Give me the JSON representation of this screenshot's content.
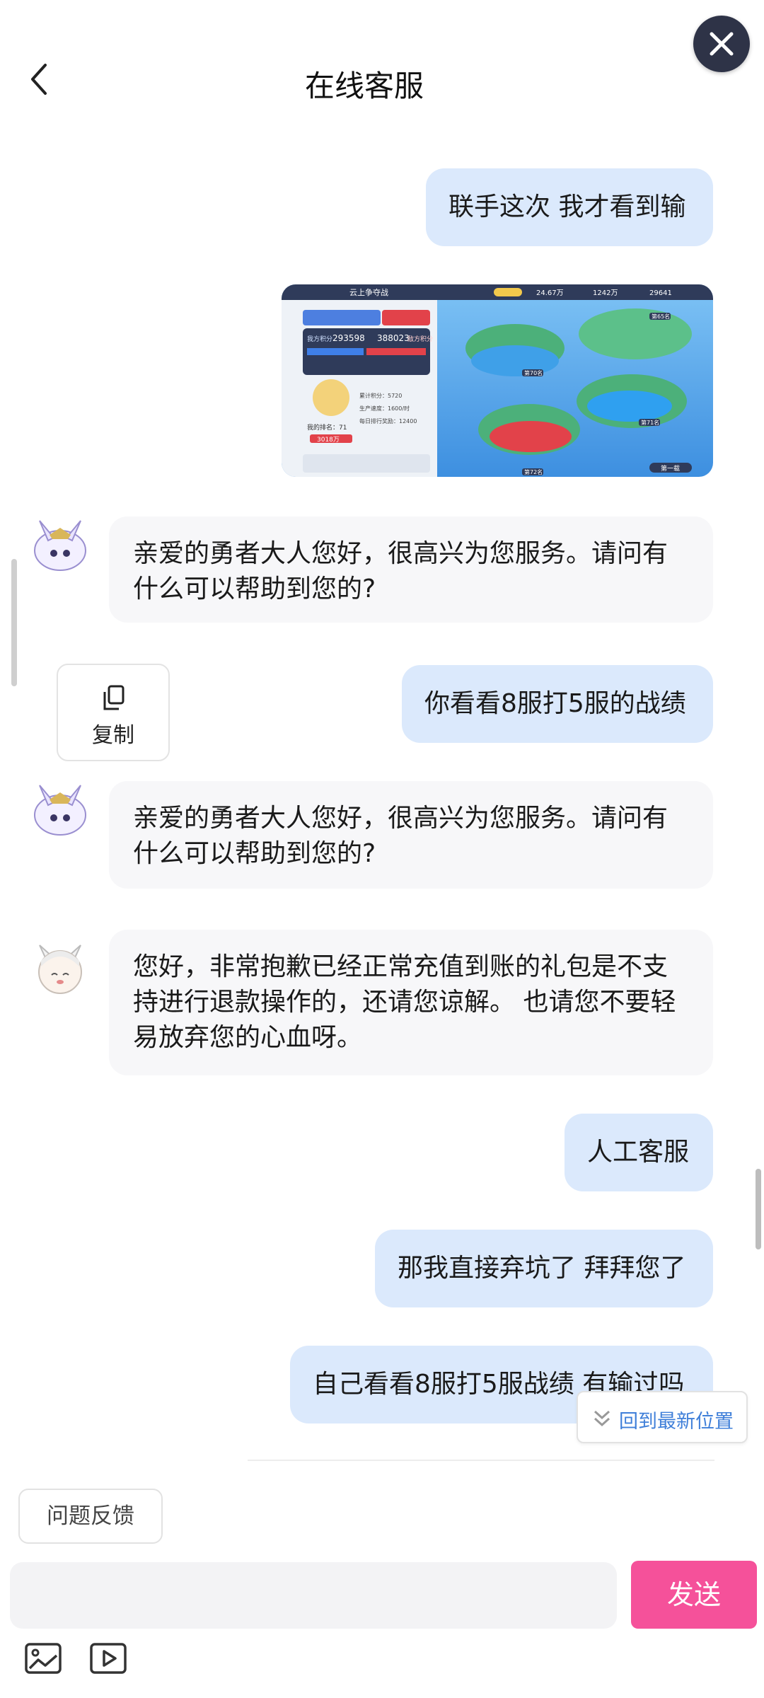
{
  "header": {
    "title": "在线客服",
    "back_icon": "back-arrow-icon",
    "close_icon": "close-icon"
  },
  "messages": [
    {
      "from": "user",
      "text": "联手这次 我才看到输"
    },
    {
      "from": "user",
      "type": "image",
      "image": {
        "header_title": "云上争夺战",
        "my_score": "293598",
        "enemy_score": "388023",
        "my_score_label": "我方积分",
        "enemy_score_label": "敌方积分",
        "rank_label": "我的排名：71",
        "cumulative_label": "累计积分：5720",
        "speed_label": "生产速度：1600/时",
        "reward_label": "每日排行奖励：12400",
        "power": "3018万",
        "resource1": "24.67万",
        "resource2": "1242万",
        "resource3": "29641",
        "node_labels": [
          "第65名",
          "第70名",
          "第71名",
          "第72名"
        ],
        "bottom_btn": "第一载"
      }
    },
    {
      "from": "agent",
      "avatar": "hero-avatar-icon",
      "text": "亲爱的勇者大人您好，很高兴为您服务。请问有什么可以帮助到您的?"
    },
    {
      "from": "user",
      "text": "你看看8服打5服的战绩"
    },
    {
      "from": "agent",
      "avatar": "hero-avatar-icon",
      "text": "亲爱的勇者大人您好，很高兴为您服务。请问有什么可以帮助到您的?"
    },
    {
      "from": "agent",
      "avatar": "catgirl-avatar-icon",
      "text": "您好，非常抱歉已经正常充值到账的礼包是不支持进行退款操作的，还请您谅解。 也请您不要轻易放弃您的心血呀。"
    },
    {
      "from": "user",
      "text": "人工客服"
    },
    {
      "from": "user",
      "text": "那我直接弃坑了 拜拜您了"
    },
    {
      "from": "user",
      "text": "自己看看8服打5服战绩 有输过吗"
    }
  ],
  "copy_popup": {
    "label": "复制",
    "icon": "copy-icon"
  },
  "jump_latest": {
    "label": "回到最新位置",
    "icon": "double-chevron-down-icon"
  },
  "feedback": {
    "label": "问题反馈"
  },
  "input": {
    "value": "",
    "placeholder": ""
  },
  "send": {
    "label": "发送"
  },
  "toolbar": {
    "icons": [
      "image-icon",
      "video-icon"
    ]
  },
  "colors": {
    "user_bubble": "#dbe9fc",
    "agent_bubble": "#f7f7f9",
    "send_button": "#f5519a",
    "link": "#3f7fd9",
    "close_button": "#2e3347"
  }
}
